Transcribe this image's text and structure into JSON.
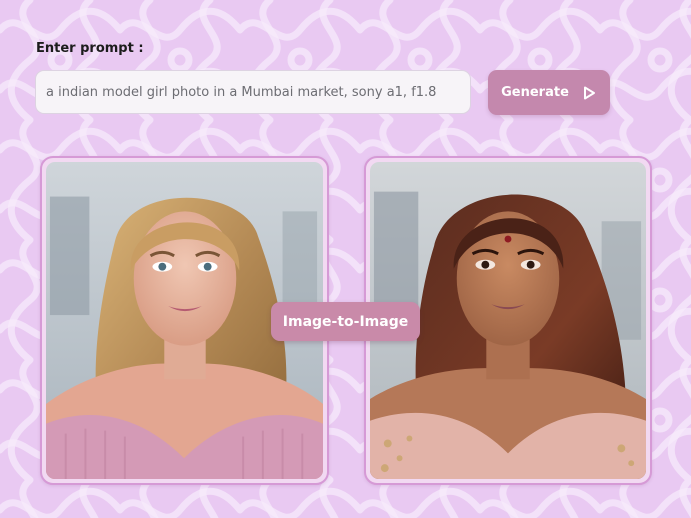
{
  "prompt_section": {
    "label": "Enter prompt :",
    "input_value": "a indian model girl photo in a Mumbai market, sony a1, f1.8"
  },
  "generate_button": {
    "label": "Generate",
    "icon": "play-icon"
  },
  "images": [
    {
      "name": "source-photo",
      "description": "blonde woman in pink knit off-shoulder sweater"
    },
    {
      "name": "result-photo",
      "description": "brunette woman with bindi in pink embroidered off-shoulder top"
    }
  ],
  "badge": {
    "label": "Image-to-Image"
  },
  "colors": {
    "background": "#e9c9f2",
    "button": "#c488ad",
    "badge": "#c98aa9",
    "card_border": "#d69ad6"
  }
}
